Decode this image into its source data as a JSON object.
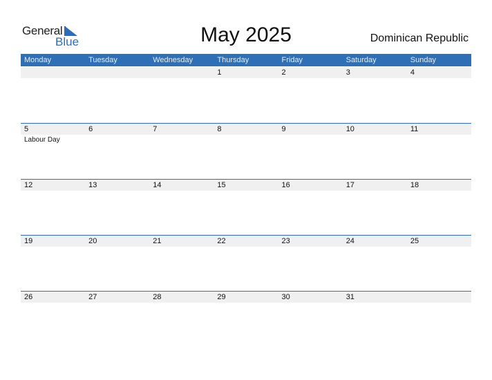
{
  "logo": {
    "general": "General",
    "blue": "Blue"
  },
  "title": "May 2025",
  "country": "Dominican Republic",
  "colors": {
    "accent": "#2e6fb5",
    "date_strip": "#f0f0f0"
  },
  "weekdays": [
    "Monday",
    "Tuesday",
    "Wednesday",
    "Thursday",
    "Friday",
    "Saturday",
    "Sunday"
  ],
  "weeks": [
    {
      "days": [
        {
          "n": "",
          "e": ""
        },
        {
          "n": "",
          "e": ""
        },
        {
          "n": "",
          "e": ""
        },
        {
          "n": "1",
          "e": ""
        },
        {
          "n": "2",
          "e": ""
        },
        {
          "n": "3",
          "e": ""
        },
        {
          "n": "4",
          "e": ""
        }
      ]
    },
    {
      "days": [
        {
          "n": "5",
          "e": "Labour Day"
        },
        {
          "n": "6",
          "e": ""
        },
        {
          "n": "7",
          "e": ""
        },
        {
          "n": "8",
          "e": ""
        },
        {
          "n": "9",
          "e": ""
        },
        {
          "n": "10",
          "e": ""
        },
        {
          "n": "11",
          "e": ""
        }
      ]
    },
    {
      "days": [
        {
          "n": "12",
          "e": ""
        },
        {
          "n": "13",
          "e": ""
        },
        {
          "n": "14",
          "e": ""
        },
        {
          "n": "15",
          "e": ""
        },
        {
          "n": "16",
          "e": ""
        },
        {
          "n": "17",
          "e": ""
        },
        {
          "n": "18",
          "e": ""
        }
      ]
    },
    {
      "days": [
        {
          "n": "19",
          "e": ""
        },
        {
          "n": "20",
          "e": ""
        },
        {
          "n": "21",
          "e": ""
        },
        {
          "n": "22",
          "e": ""
        },
        {
          "n": "23",
          "e": ""
        },
        {
          "n": "24",
          "e": ""
        },
        {
          "n": "25",
          "e": ""
        }
      ]
    },
    {
      "days": [
        {
          "n": "26",
          "e": ""
        },
        {
          "n": "27",
          "e": ""
        },
        {
          "n": "28",
          "e": ""
        },
        {
          "n": "29",
          "e": ""
        },
        {
          "n": "30",
          "e": ""
        },
        {
          "n": "31",
          "e": ""
        },
        {
          "n": "",
          "e": ""
        }
      ]
    }
  ]
}
